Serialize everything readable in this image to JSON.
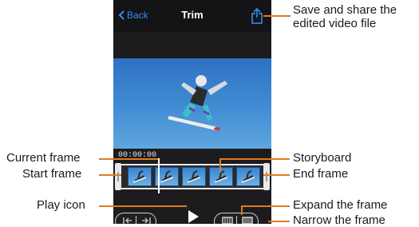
{
  "nav": {
    "back_label": "Back",
    "title": "Trim"
  },
  "video": {
    "timecode": "00:00:00"
  },
  "storyboard": {
    "frame_count": 5
  },
  "callouts": {
    "save_share": [
      "Save and share the",
      "edited video file"
    ],
    "current_frame": "Current frame",
    "start_frame": "Start frame",
    "play_icon": "Play icon",
    "storyboard": "Storyboard",
    "end_frame": "End frame",
    "expand_frame": "Expand the frame",
    "narrow_frame": "Narrow the frame"
  },
  "colors": {
    "accent_blue": "#2f8ff0",
    "leader_orange": "#e07a1c"
  },
  "icons": {
    "share": "share-icon",
    "back": "chevron-left-icon",
    "play": "play-icon",
    "expand": "expand-frame-icon",
    "narrow": "narrow-frame-icon"
  }
}
